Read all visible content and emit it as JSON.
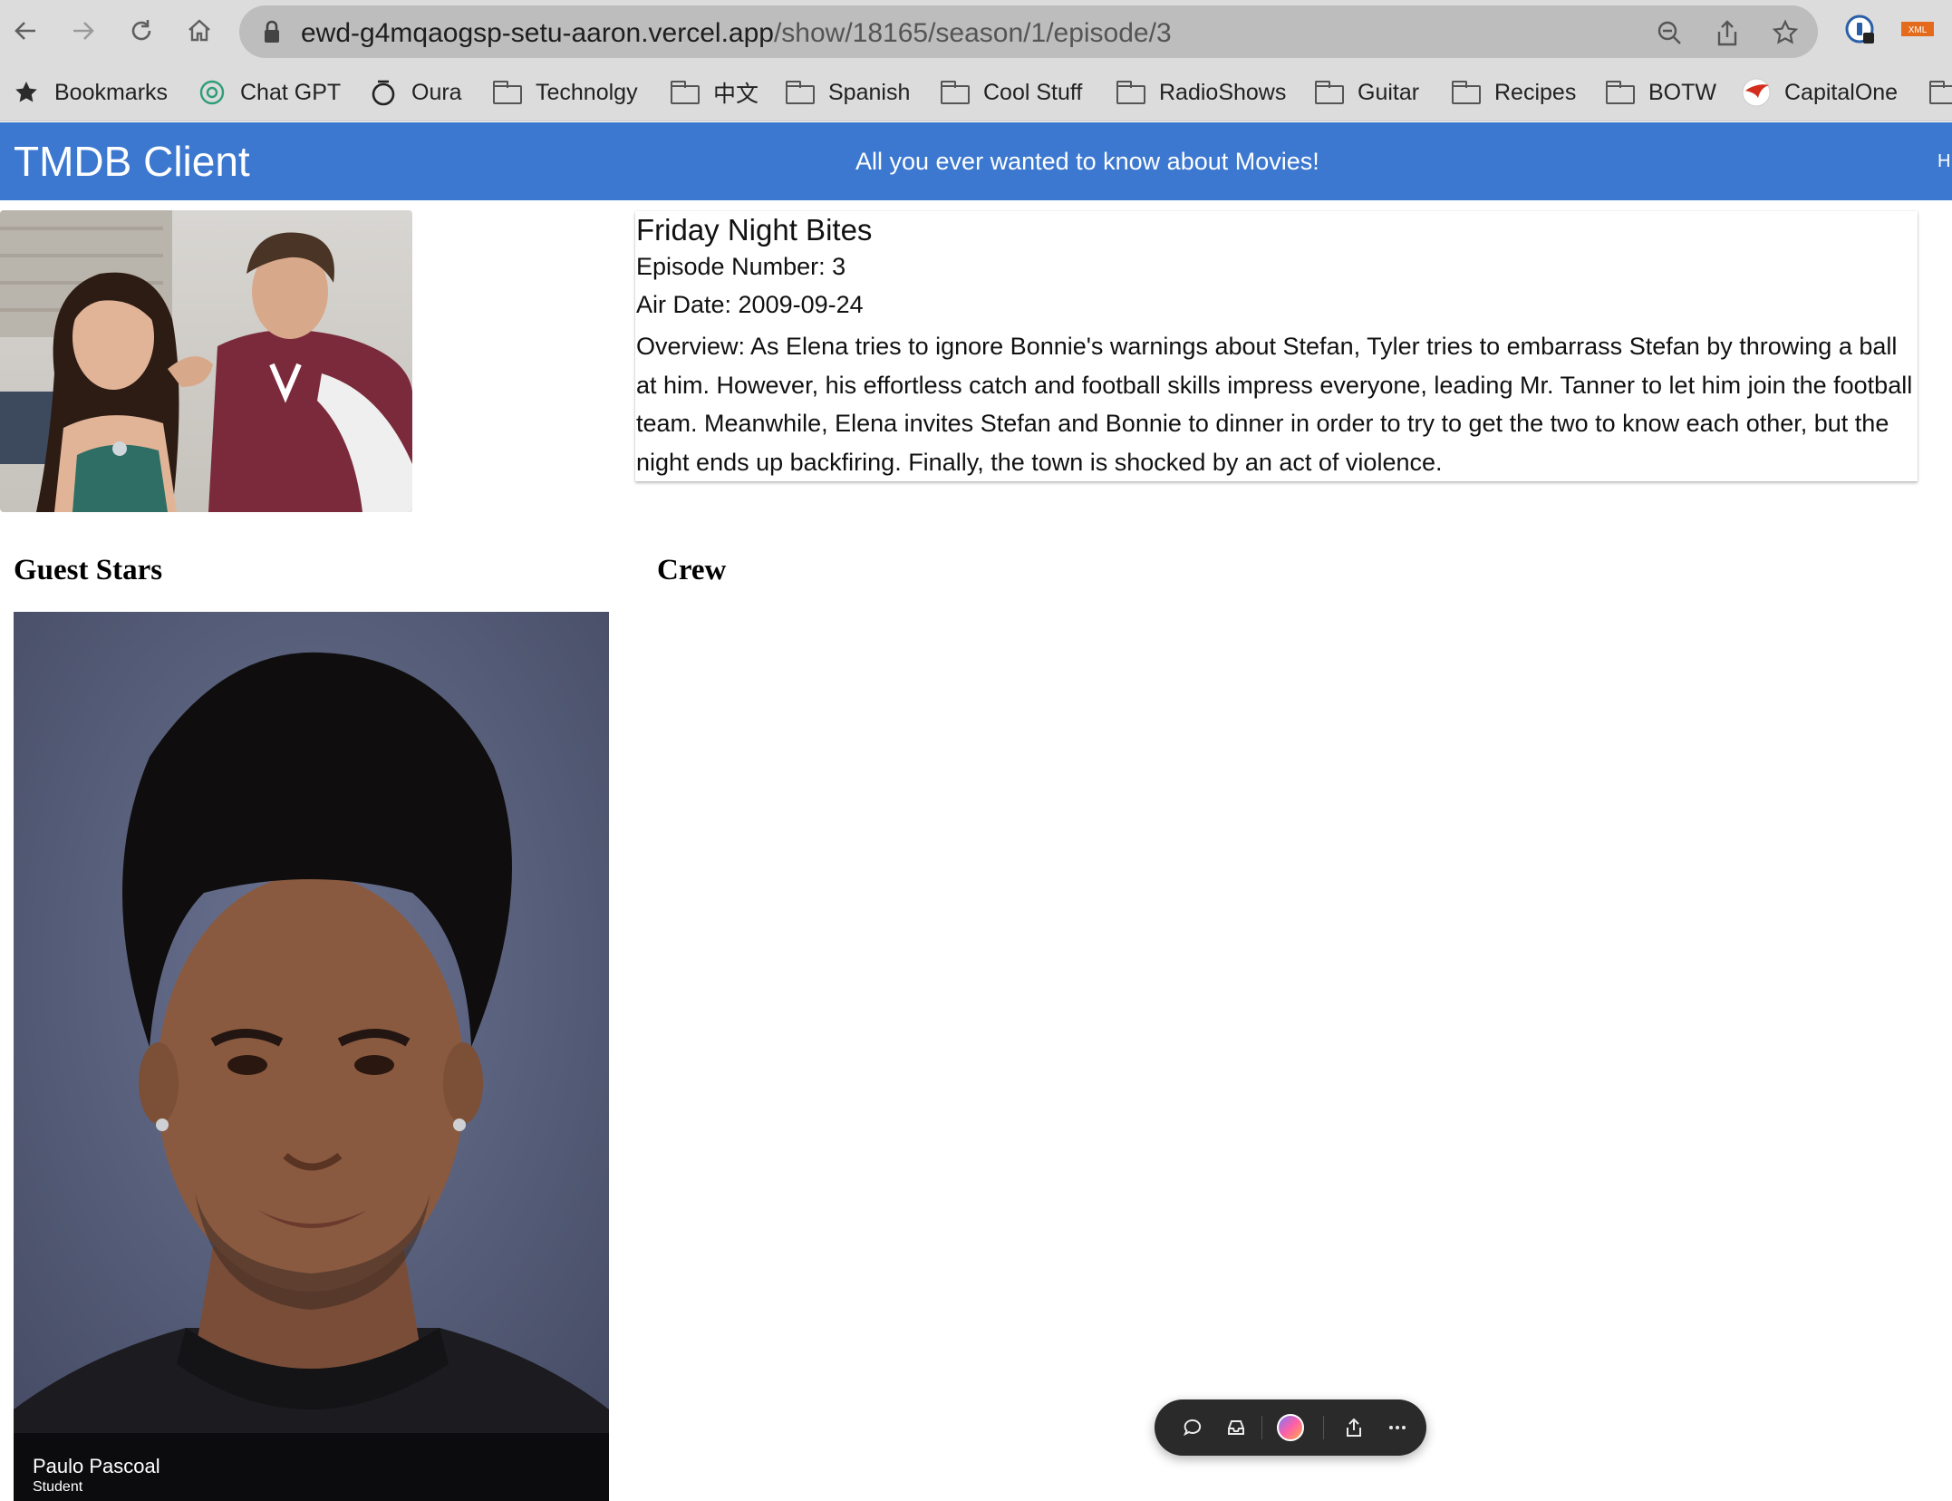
{
  "browser": {
    "url_host": "ewd-g4mqaogsp-setu-aaron.vercel.app",
    "url_path": "/show/18165/season/1/episode/3",
    "bookmarks": [
      {
        "label": "Bookmarks",
        "icon": "star-icon"
      },
      {
        "label": "Chat GPT",
        "icon": "chatgpt-icon"
      },
      {
        "label": "Oura",
        "icon": "oura-ring-icon"
      },
      {
        "label": "Technolgy",
        "icon": "folder-icon"
      },
      {
        "label": "中文",
        "icon": "folder-icon"
      },
      {
        "label": "Spanish",
        "icon": "folder-icon"
      },
      {
        "label": "Cool Stuff",
        "icon": "folder-icon"
      },
      {
        "label": "RadioShows",
        "icon": "folder-icon"
      },
      {
        "label": "Guitar",
        "icon": "folder-icon"
      },
      {
        "label": "Recipes",
        "icon": "folder-icon"
      },
      {
        "label": "BOTW",
        "icon": "folder-icon"
      },
      {
        "label": "CapitalOne",
        "icon": "capitalone-icon"
      }
    ],
    "extension_badge": "XML"
  },
  "app": {
    "brand": "TMDB Client",
    "tagline": "All you ever wanted to know about Movies!",
    "overflow_text": "H",
    "accent_color": "#3c78d0"
  },
  "episode": {
    "title": "Friday Night Bites",
    "number_line": "Episode Number: 3",
    "air_date_line": "Air Date: 2009-09-24",
    "overview": "Overview: As Elena tries to ignore Bonnie's warnings about Stefan, Tyler tries to embarrass Stefan by throwing a ball at him. However, his effortless catch and football skills impress everyone, leading Mr. Tanner to let him join the football team. Meanwhile, Elena invites Stefan and Bonnie to dinner in order to try to get the two to know each other, but the night ends up backfiring. Finally, the town is shocked by an act of violence."
  },
  "sections": {
    "guest_stars": "Guest Stars",
    "crew": "Crew"
  },
  "guest_stars": [
    {
      "name": "Paulo Pascoal",
      "role": "Student"
    }
  ]
}
